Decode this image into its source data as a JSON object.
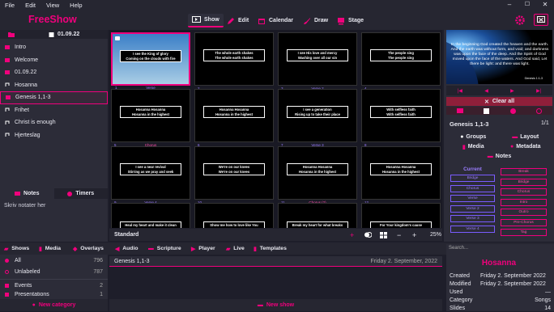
{
  "menu": [
    "File",
    "Edit",
    "View",
    "Help"
  ],
  "app_title": "FreeShow",
  "nav": {
    "show": "Show",
    "edit": "Edit",
    "calendar": "Calendar",
    "draw": "Draw",
    "stage": "Stage"
  },
  "left": {
    "date": "01.09.22",
    "items": [
      "Intro",
      "Welcome",
      "01.09.22",
      "Hosanna",
      "Genesis 1,1-3",
      "Frihet",
      "Christ is enough",
      "Hjerteslag"
    ],
    "notes_tab": "Notes",
    "timers_tab": "Timers",
    "notes_text": "Skriv notater her"
  },
  "slides": [
    {
      "n": "1",
      "group": "Verse",
      "text": "I see the King of glory\nComing on the clouds with fire"
    },
    {
      "n": "2",
      "group": "",
      "text": "The whole earth shakes\nThe whole earth shakes"
    },
    {
      "n": "3",
      "group": "Verse 2",
      "text": "I see His love and mercy\nWashing over all our sin"
    },
    {
      "n": "4",
      "group": "",
      "text": "The people sing\nThe people sing"
    },
    {
      "n": "5",
      "group": "Chorus",
      "text": "Hosanna Hosanna\nHosanna in the highest"
    },
    {
      "n": "6",
      "group": "",
      "text": "Hosanna Hosanna\nHosanna in the highest"
    },
    {
      "n": "7",
      "group": "Verse 3",
      "text": "I see a generation\nRising up to take their place"
    },
    {
      "n": "8",
      "group": "",
      "text": "With selfless faith\nWith selfless faith"
    },
    {
      "n": "9",
      "group": "Verse 4",
      "text": "I see a near revival\nStirring as we pray and seek"
    },
    {
      "n": "10",
      "group": "",
      "text": "We're on our knees\nWe're on our knees"
    },
    {
      "n": "11",
      "group": "Chorus (2)",
      "text": "Hosanna Hosanna\nHosanna in the highest"
    },
    {
      "n": "12",
      "group": "",
      "text": "Hosanna Hosanna\nHosanna in the highest"
    },
    {
      "n": "",
      "group": "",
      "text": "Heal my heart and make it clean"
    },
    {
      "n": "",
      "group": "",
      "text": "Show me how to love like You"
    },
    {
      "n": "",
      "group": "",
      "text": "Break my heart for what breaks Yours"
    },
    {
      "n": "",
      "group": "",
      "text": "For Your kingdom's cause"
    }
  ],
  "slidebar": {
    "layout": "Standard",
    "zoom": "25%"
  },
  "preview": {
    "text": "In the beginning God created the heaven and the earth. And the earth was without form, and void; and darkness was upon the face of the deep. And the Spirit of God moved upon the face of the waters. And God said, Let there be light: and there was light.",
    "ref": "Genesis 1:1-3"
  },
  "right": {
    "clear_all": "Clear all",
    "show_name": "Genesis 1,1-3",
    "page": "1/1",
    "tabs": {
      "groups": "Groups",
      "layout": "Layout",
      "media": "Media",
      "metadata": "Metadata",
      "notes": "Notes"
    },
    "current_label": "Current",
    "current": [
      "Bridge",
      "Chorus",
      "Verse",
      "Verse 2",
      "Verse 3",
      "Verse 4"
    ],
    "groups": [
      "Break",
      "Bridge",
      "Chorus",
      "Intro",
      "Outro",
      "Pre-Chorus",
      "Tag"
    ]
  },
  "bottom_tabs": {
    "shows": "Shows",
    "media": "Media",
    "overlays": "Overlays",
    "audio": "Audio",
    "scripture": "Scripture",
    "player": "Player",
    "live": "Live",
    "templates": "Templates"
  },
  "categories": [
    {
      "name": "All",
      "count": "796"
    },
    {
      "name": "Unlabeled",
      "count": "787"
    },
    {
      "name": "Events",
      "count": "2"
    },
    {
      "name": "Presentations",
      "count": "1"
    }
  ],
  "new_category": "New category",
  "list": {
    "name": "Genesis 1,1-3",
    "date": "Friday 2. September, 2022"
  },
  "new_show": "New show",
  "info": {
    "search": "Search...",
    "title": "Hosanna",
    "rows": [
      {
        "k": "Created",
        "v": "Friday 2. September 2022"
      },
      {
        "k": "Modified",
        "v": "Friday 2. September 2022"
      },
      {
        "k": "Used",
        "v": "—"
      },
      {
        "k": "Category",
        "v": "Songs"
      },
      {
        "k": "Slides",
        "v": "14"
      }
    ]
  },
  "colors": {
    "accent": "#f0007c",
    "group": "#7a5cff"
  }
}
